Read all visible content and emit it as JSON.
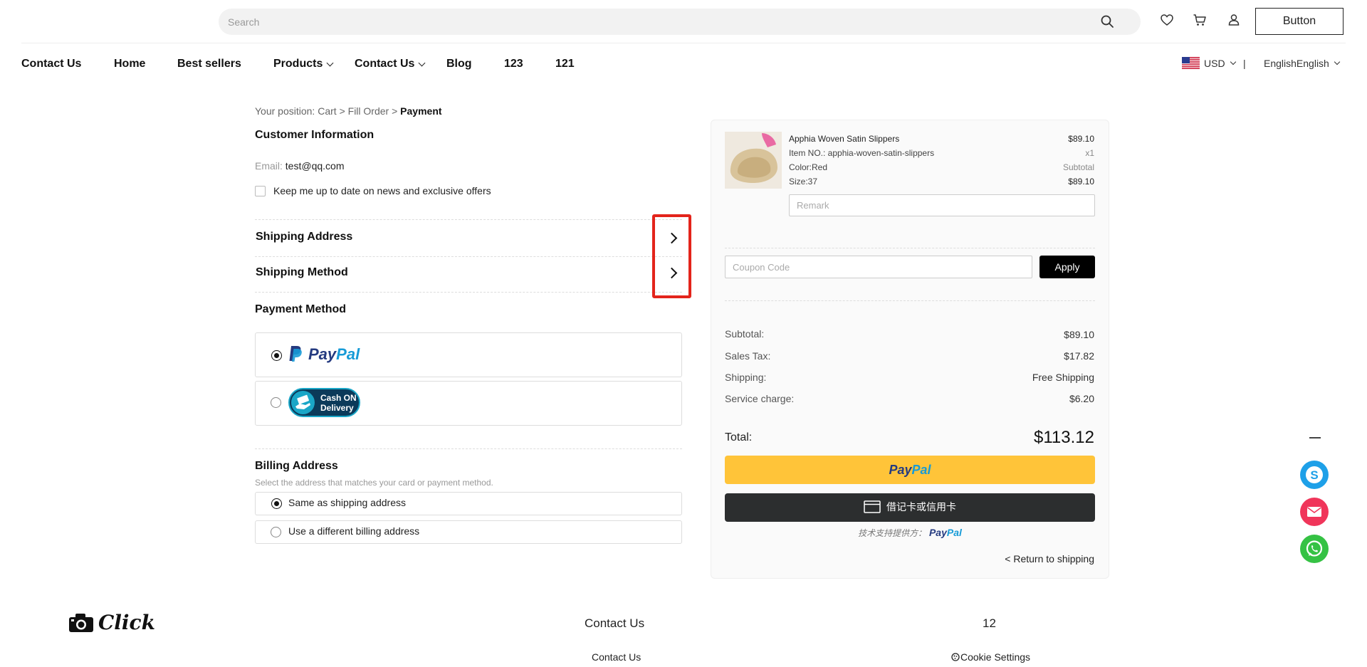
{
  "header": {
    "search_placeholder": "Search",
    "button_label": "Button",
    "icons": [
      "heart-icon",
      "cart-icon",
      "user-icon",
      "search-icon"
    ]
  },
  "nav": {
    "items": [
      {
        "label": "Contact Us",
        "dropdown": false
      },
      {
        "label": "Home",
        "dropdown": false
      },
      {
        "label": "Best sellers",
        "dropdown": false
      },
      {
        "label": "Products",
        "dropdown": true
      },
      {
        "label": "Contact Us",
        "dropdown": true
      },
      {
        "label": "Blog",
        "dropdown": false
      },
      {
        "label": "123",
        "dropdown": false
      },
      {
        "label": "121",
        "dropdown": false
      }
    ],
    "currency": "USD",
    "separator": "|",
    "language": "EnglishEnglish"
  },
  "breadcrumb": {
    "prefix": "Your position:",
    "cart": "Cart",
    "sep1": ">",
    "fill_order": "Fill Order",
    "sep2": ">",
    "current": "Payment"
  },
  "customer": {
    "title": "Customer Information",
    "email_label": "Email:",
    "email_value": "test@qq.com",
    "newsletter_label": "Keep me up to date on news and exclusive offers"
  },
  "sections": {
    "shipping_address": "Shipping Address",
    "shipping_method": "Shipping Method",
    "payment_method": "Payment Method"
  },
  "payment": {
    "paypal_dark": "Pay",
    "paypal_light": "Pal",
    "cod_line1": "Cash ON",
    "cod_line2": "Delivery"
  },
  "billing": {
    "title": "Billing Address",
    "subtitle": "Select the address that matches your card or payment method.",
    "option_same": "Same as shipping address",
    "option_different": "Use a different billing address"
  },
  "order": {
    "product": {
      "name": "Apphia Woven Satin Slippers",
      "price": "$89.10",
      "item_no": "Item NO.: apphia-woven-satin-slippers",
      "qty": "x1",
      "color": "Color:Red",
      "subtotal_label": "Subtotal",
      "size": "Size:37",
      "subtotal_value": "$89.10"
    },
    "remark_placeholder": "Remark",
    "coupon_placeholder": "Coupon Code",
    "apply_label": "Apply",
    "summary": [
      {
        "label": "Subtotal:",
        "value": "$89.10"
      },
      {
        "label": "Sales Tax:",
        "value": "$17.82"
      },
      {
        "label": "Shipping:",
        "value": "Free Shipping"
      },
      {
        "label": "Service charge:",
        "value": "$6.20"
      }
    ],
    "total_label": "Total:",
    "total_value": "$113.12",
    "paypal_btn_dark": "Pay",
    "paypal_btn_light": "Pal",
    "card_btn_label": "借记卡或信用卡",
    "powered_prefix": "技术支持提供方：",
    "powered_dark": "Pay",
    "powered_light": "Pal",
    "return_label": "< Return to shipping"
  },
  "floating": {
    "icons": [
      "minimize-icon",
      "skype-icon",
      "email-icon",
      "whatsapp-icon"
    ],
    "colors": {
      "skype": "#1ea0e8",
      "email": "#f0355a",
      "whatsapp": "#35c244"
    }
  },
  "footer": {
    "logo_text": "Click",
    "col1_title": "Contact Us",
    "col1_link": "Contact Us",
    "col2_title": "12",
    "col2_link": "Cookie Settings"
  },
  "colors": {
    "highlight": "#e3241b",
    "paypal_yellow": "#ffc439",
    "paypal_dark": "#253b80",
    "paypal_light": "#179bd7"
  }
}
